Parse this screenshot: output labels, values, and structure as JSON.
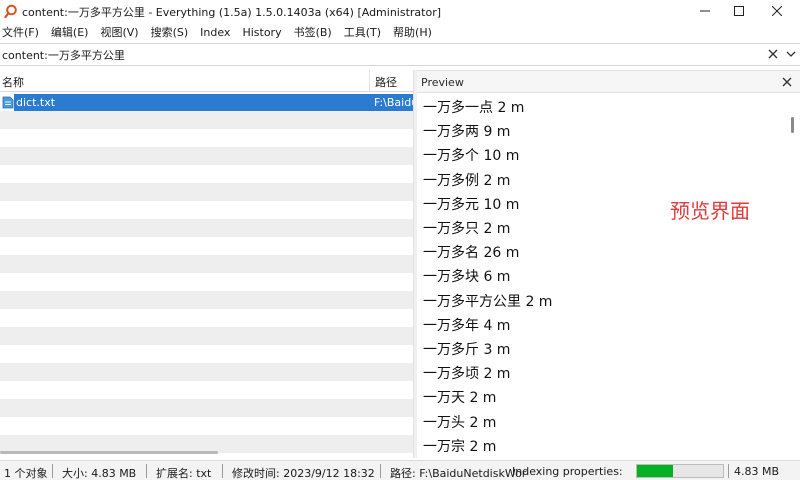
{
  "window": {
    "title": "content:一万多平方公里 - Everything (1.5a) 1.5.0.1403a (x64) [Administrator]"
  },
  "menu": [
    {
      "label": "文件(F)"
    },
    {
      "label": "编辑(E)"
    },
    {
      "label": "视图(V)"
    },
    {
      "label": "搜索(S)"
    },
    {
      "label": "Index"
    },
    {
      "label": "History"
    },
    {
      "label": "书签(B)"
    },
    {
      "label": "工具(T)"
    },
    {
      "label": "帮助(H)"
    }
  ],
  "search": {
    "value": "content:一万多平方公里"
  },
  "results": {
    "columns": {
      "name": "名称",
      "path": "路径"
    },
    "rows": [
      {
        "name": "dict.txt",
        "path": "F:\\BaiduNetdiskWor",
        "icon": "text-file-icon",
        "selected": true
      }
    ]
  },
  "preview": {
    "title": "Preview",
    "lines": [
      "一万多一点 2 m",
      "一万多两 9 m",
      "一万多个 10 m",
      "一万多例 2 m",
      "一万多元 10 m",
      "一万多只 2 m",
      "一万多名 26 m",
      "一万多块 6 m",
      "一万多平方公里 2 m",
      "一万多年 4 m",
      "一万多斤 3 m",
      "一万多顷 2 m",
      "一万天 2 m",
      "一万头 2 m",
      "一万宗 2 m"
    ],
    "annotation": "预览界面"
  },
  "status": {
    "objects": "1 个对象",
    "size": "大小: 4.83 MB",
    "extension": "扩展名: txt",
    "modified": "修改时间: 2023/9/12 18:32",
    "path": "路径: F:\\BaiduNetdiskWor",
    "indexing": "Indexing properties:",
    "indexing_progress": 0.42,
    "total_size": "4.83 MB"
  },
  "colors": {
    "selection": "#2b7bd1",
    "annotation": "#e23a3a",
    "progress": "#06b025"
  }
}
